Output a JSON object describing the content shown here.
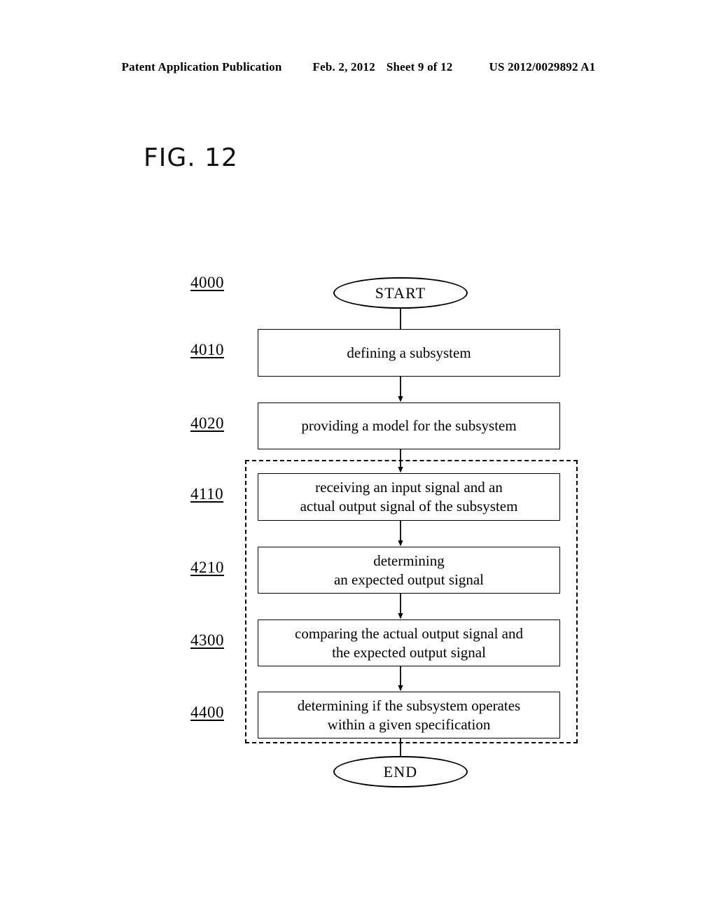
{
  "header": {
    "publication": "Patent Application Publication",
    "date": "Feb. 2, 2012",
    "sheet": "Sheet 9 of 12",
    "publication_number": "US 2012/0029892 A1"
  },
  "figure": {
    "label": "FIG. 12"
  },
  "flowchart": {
    "start": {
      "ref": "4000",
      "label": "START"
    },
    "end": {
      "label": "END"
    },
    "steps": [
      {
        "ref": "4010",
        "text": "defining a subsystem"
      },
      {
        "ref": "4020",
        "text": "providing a model for the subsystem"
      },
      {
        "ref": "4110",
        "text": "receiving an input signal and an\nactual output signal of the subsystem"
      },
      {
        "ref": "4210",
        "text": "determining\nan expected output signal"
      },
      {
        "ref": "4300",
        "text": "comparing the actual output signal and\nthe expected output signal"
      },
      {
        "ref": "4400",
        "text": "determining if the subsystem operates\nwithin a given specification"
      }
    ]
  },
  "colors": {
    "ink": "#000000",
    "paper": "#ffffff"
  }
}
